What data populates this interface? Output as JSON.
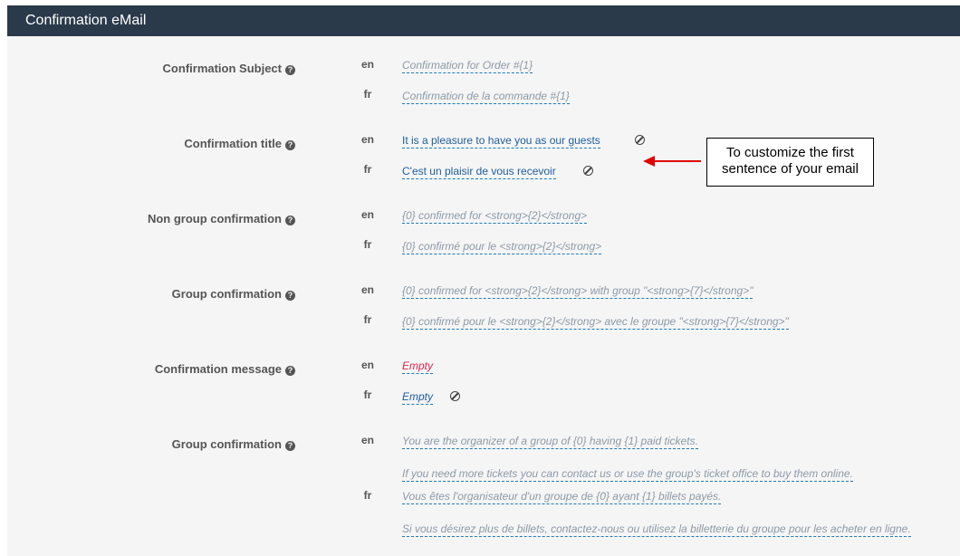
{
  "panel": {
    "title": "Confirmation eMail"
  },
  "help_glyph": "?",
  "fields": [
    {
      "label": "Confirmation Subject",
      "rows": [
        {
          "lang": "en",
          "value": "Confirmation for Order #{1}"
        },
        {
          "lang": "fr",
          "value": "Confirmation de la commande #{1}"
        }
      ]
    },
    {
      "label": "Confirmation title",
      "rows": [
        {
          "lang": "en",
          "value": "It is a pleasure to have you as our guests"
        },
        {
          "lang": "fr",
          "value": "C'est un plaisir de vous recevoir"
        }
      ]
    },
    {
      "label": "Non group confirmation",
      "rows": [
        {
          "lang": "en",
          "value": "{0} confirmed for <strong>{2}</strong>"
        },
        {
          "lang": "fr",
          "value": "{0} confirmé pour le <strong>{2}</strong>"
        }
      ]
    },
    {
      "label": "Group confirmation",
      "rows": [
        {
          "lang": "en",
          "value": "{0} confirmed for <strong>{2}</strong> with group \"<strong>{7}</strong>\""
        },
        {
          "lang": "fr",
          "value": "{0} confirmé pour le <strong>{2}</strong> avec le groupe \"<strong>{7}</strong>\""
        }
      ]
    },
    {
      "label": "Confirmation message",
      "rows": [
        {
          "lang": "en",
          "value": "Empty"
        },
        {
          "lang": "fr",
          "value": "Empty"
        }
      ]
    },
    {
      "label": "Group confirmation",
      "rows": [
        {
          "lang": "en",
          "lines": [
            "You are the organizer of a group of {0} having {1} paid tickets.",
            "If you need more tickets you can contact us or use the group's ticket office to buy them online."
          ]
        },
        {
          "lang": "fr",
          "lines": [
            "Vous êtes l'organisateur d'un groupe de {0} ayant {1} billets payés.",
            "Si vous désirez plus de billets, contactez-nous ou utilisez la billetterie du groupe pour les acheter en ligne."
          ]
        }
      ]
    }
  ],
  "annotation": {
    "text": "To customize the first sentence of your email",
    "color": "#e00000"
  },
  "colors": {
    "header_bg": "#2b3a4a",
    "default_value": "#8c9aa8",
    "custom_value": "#1f5e9e",
    "empty_value": "#d9294d"
  }
}
